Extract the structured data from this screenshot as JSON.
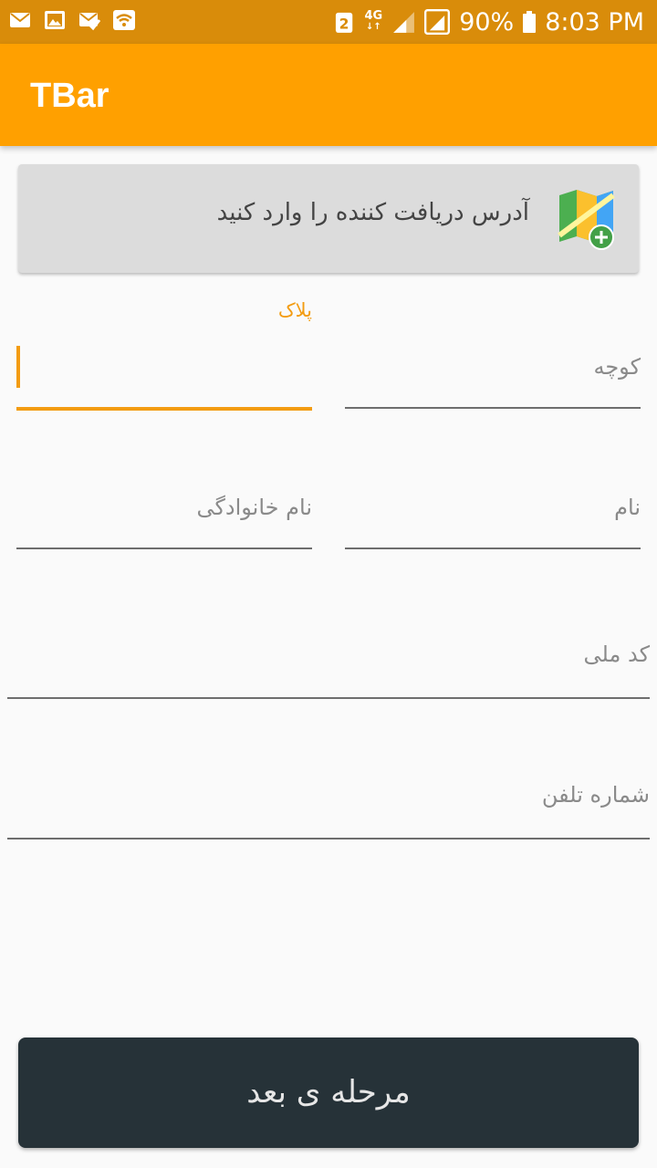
{
  "status_bar": {
    "left_icons": [
      "mail-icon",
      "image-icon",
      "mail-check-icon",
      "wifi-icon"
    ],
    "sim_badge": "2",
    "network": "4G",
    "battery": "90%",
    "time": "8:03 PM"
  },
  "app_bar": {
    "title": "TBar"
  },
  "address_card": {
    "text": "آدرس دریافت کننده را وارد کنید",
    "icon": "map-add-icon"
  },
  "fields": {
    "plate": {
      "label": "پلاک"
    },
    "alley": {
      "placeholder": "کوچه"
    },
    "last_name": {
      "placeholder": "نام خانوادگی"
    },
    "first_name": {
      "placeholder": "نام"
    },
    "national_code": {
      "placeholder": "کد ملی"
    },
    "phone": {
      "placeholder": "شماره تلفن"
    }
  },
  "next_button": {
    "label": "مرحله ی بعد"
  },
  "colors": {
    "status_bar": "#d98c0a",
    "app_bar": "#ffa000",
    "accent": "#f39c12",
    "button": "#263238"
  }
}
